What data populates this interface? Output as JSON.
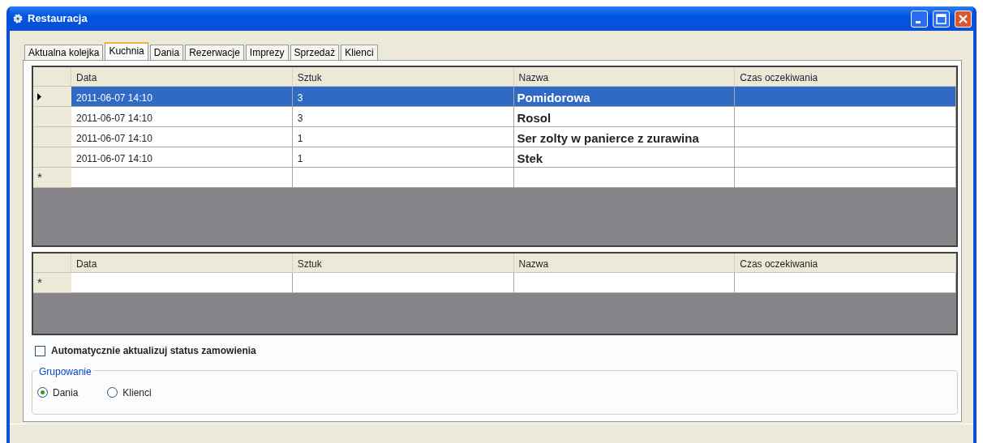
{
  "window": {
    "title": "Restauracja"
  },
  "tabs": [
    {
      "label": "Aktualna kolejka",
      "selected": false
    },
    {
      "label": "Kuchnia",
      "selected": true
    },
    {
      "label": "Dania",
      "selected": false
    },
    {
      "label": "Rezerwacje",
      "selected": false
    },
    {
      "label": "Imprezy",
      "selected": false
    },
    {
      "label": "Sprzedaż",
      "selected": false
    },
    {
      "label": "Klienci",
      "selected": false
    }
  ],
  "orders_grid": {
    "columns": [
      "Data",
      "Sztuk",
      "Nazwa",
      "Czas oczekiwania"
    ],
    "rows": [
      {
        "cells": [
          "2011-06-07 14:10",
          "3",
          "Pomidorowa"
        ],
        "selected": true
      },
      {
        "cells": [
          "2011-06-07 14:10",
          "3",
          "Rosol"
        ],
        "selected": false
      },
      {
        "cells": [
          "2011-06-07 14:10",
          "1",
          "Ser zolty w panierce z zurawina"
        ],
        "selected": false
      },
      {
        "cells": [
          "2011-06-07 14:10",
          "1",
          "Stek"
        ],
        "selected": false
      }
    ],
    "new_row_marker": "*"
  },
  "details_grid": {
    "columns": [
      "Data",
      "Sztuk",
      "Nazwa",
      "Czas oczekiwania"
    ],
    "new_row_marker": "*"
  },
  "auto_update": {
    "label": "Automatycznie aktualizuj status zamowienia",
    "checked": false
  },
  "grouping": {
    "title": "Grupowanie",
    "options": [
      {
        "label": "Dania",
        "selected": true
      },
      {
        "label": "Klienci",
        "selected": false
      }
    ]
  }
}
